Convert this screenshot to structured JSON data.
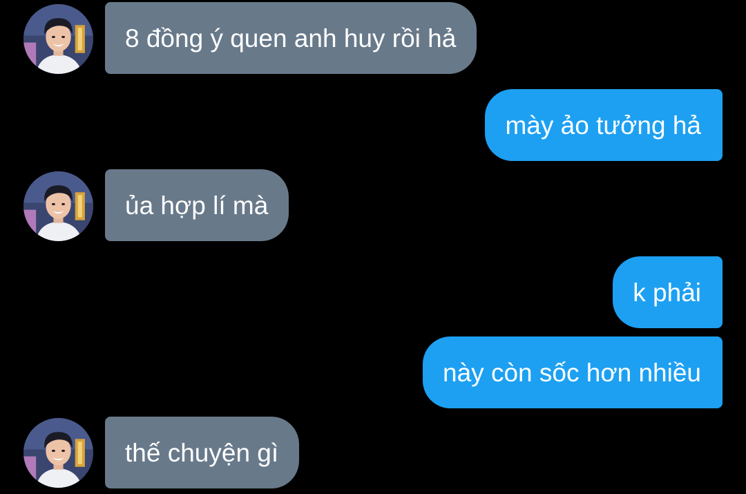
{
  "colors": {
    "background": "#000000",
    "received_bubble": "#68798a",
    "sent_bubble": "#1da0f2",
    "text": "#ffffff"
  },
  "contact": {
    "avatar_icon": "contact-avatar-photo"
  },
  "messages": [
    {
      "direction": "received",
      "text": "8 đồng ý quen anh huy rồi hả"
    },
    {
      "direction": "sent",
      "text": "mày ảo tưởng hả"
    },
    {
      "direction": "received",
      "text": "ủa hợp lí mà"
    },
    {
      "direction": "sent",
      "text": "k phải"
    },
    {
      "direction": "sent",
      "text": "này còn sốc hơn nhiều"
    },
    {
      "direction": "received",
      "text": "thế chuyện gì"
    }
  ]
}
